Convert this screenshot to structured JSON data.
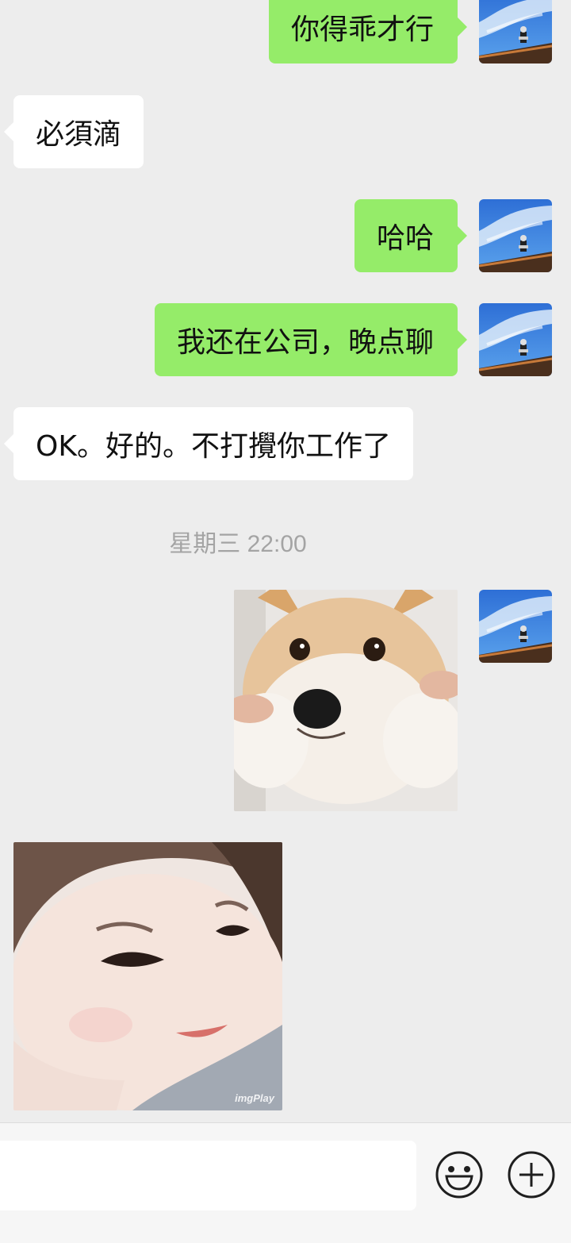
{
  "messages": [
    {
      "side": "sent",
      "type": "text",
      "text": "你得乖才行"
    },
    {
      "side": "received",
      "type": "text",
      "text": "必須滴"
    },
    {
      "side": "sent",
      "type": "text",
      "text": "哈哈"
    },
    {
      "side": "sent",
      "type": "text",
      "text": "我还在公司，晚点聊"
    },
    {
      "side": "received",
      "type": "text",
      "text": "OK。好的。不打攪你工作了"
    },
    {
      "side": "sent",
      "type": "image",
      "image": "shiba-dog-sticker"
    },
    {
      "side": "received",
      "type": "image",
      "image": "child-smiling-sticker",
      "watermark": "imgPlay"
    }
  ],
  "timestamp": "星期三 22:00",
  "input_bar": {
    "text_value": "",
    "emoji_icon": "emoji-smile-icon",
    "add_icon": "plus-circle-icon"
  },
  "colors": {
    "background": "#ededed",
    "sent_bubble": "#95ec69",
    "received_bubble": "#ffffff",
    "timestamp_text": "#a4a4a4"
  }
}
